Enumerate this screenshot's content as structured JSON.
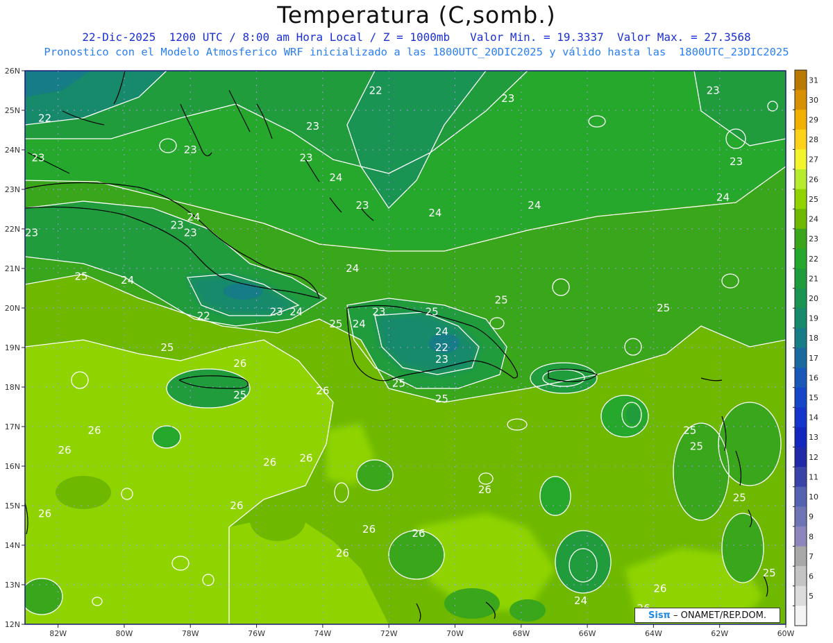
{
  "header": {
    "title": "Temperatura (C,somb.)",
    "line1": "22-Dic-2025  1200 UTC / 8:00 am Hora Local / Z = 1000mb   Valor Min. = 19.3337  Valor Max. = 27.3568",
    "line2": "Pronostico con el Modelo Atmosferico WRF inicializado a las 1800UTC_20DIC2025 y válido hasta las  1800UTC_23DIC2025"
  },
  "map": {
    "lat_labels": [
      "26N",
      "25N",
      "24N",
      "23N",
      "22N",
      "21N",
      "20N",
      "19N",
      "18N",
      "17N",
      "16N",
      "15N",
      "14N",
      "13N",
      "12N"
    ],
    "lon_labels": [
      "82W",
      "80W",
      "78W",
      "76W",
      "74W",
      "72W",
      "70W",
      "68W",
      "66W",
      "64W",
      "62W",
      "60W"
    ],
    "contour_labels": [
      {
        "text": "22",
        "lon": -82.4,
        "lat": 24.8
      },
      {
        "text": "23",
        "lon": -82.6,
        "lat": 23.8
      },
      {
        "text": "23",
        "lon": -82.8,
        "lat": 21.9
      },
      {
        "text": "25",
        "lon": -81.3,
        "lat": 20.8
      },
      {
        "text": "24",
        "lon": -79.9,
        "lat": 20.7
      },
      {
        "text": "23",
        "lon": -78.0,
        "lat": 24.0
      },
      {
        "text": "24",
        "lon": -77.9,
        "lat": 22.3
      },
      {
        "text": "23",
        "lon": -78.4,
        "lat": 22.1
      },
      {
        "text": "23",
        "lon": -78.0,
        "lat": 21.9
      },
      {
        "text": "22",
        "lon": -77.6,
        "lat": 19.8
      },
      {
        "text": "23",
        "lon": -74.3,
        "lat": 24.6
      },
      {
        "text": "23",
        "lon": -74.5,
        "lat": 23.8
      },
      {
        "text": "24",
        "lon": -73.6,
        "lat": 23.3
      },
      {
        "text": "23",
        "lon": -75.4,
        "lat": 19.9
      },
      {
        "text": "24",
        "lon": -74.8,
        "lat": 19.9
      },
      {
        "text": "25",
        "lon": -78.7,
        "lat": 19.0
      },
      {
        "text": "26",
        "lon": -76.5,
        "lat": 18.6
      },
      {
        "text": "25",
        "lon": -76.5,
        "lat": 17.8
      },
      {
        "text": "26",
        "lon": -80.9,
        "lat": 16.9
      },
      {
        "text": "26",
        "lon": -81.8,
        "lat": 16.4
      },
      {
        "text": "26",
        "lon": -82.4,
        "lat": 14.8
      },
      {
        "text": "26",
        "lon": -76.6,
        "lat": 15.0
      },
      {
        "text": "26",
        "lon": -75.6,
        "lat": 16.1
      },
      {
        "text": "26",
        "lon": -74.5,
        "lat": 16.2
      },
      {
        "text": "26",
        "lon": -74.0,
        "lat": 17.9
      },
      {
        "text": "25",
        "lon": -73.6,
        "lat": 19.6
      },
      {
        "text": "24",
        "lon": -72.9,
        "lat": 19.6
      },
      {
        "text": "23",
        "lon": -72.3,
        "lat": 19.9
      },
      {
        "text": "25",
        "lon": -70.7,
        "lat": 19.9
      },
      {
        "text": "24",
        "lon": -70.4,
        "lat": 19.4
      },
      {
        "text": "22",
        "lon": -70.4,
        "lat": 19.0
      },
      {
        "text": "23",
        "lon": -70.4,
        "lat": 18.7
      },
      {
        "text": "25",
        "lon": -71.7,
        "lat": 18.1
      },
      {
        "text": "25",
        "lon": -70.4,
        "lat": 17.7
      },
      {
        "text": "22",
        "lon": -72.4,
        "lat": 25.5
      },
      {
        "text": "23",
        "lon": -72.8,
        "lat": 22.6
      },
      {
        "text": "24",
        "lon": -73.1,
        "lat": 21.0
      },
      {
        "text": "24",
        "lon": -70.6,
        "lat": 22.4
      },
      {
        "text": "23",
        "lon": -68.4,
        "lat": 25.3
      },
      {
        "text": "24",
        "lon": -67.6,
        "lat": 22.6
      },
      {
        "text": "25",
        "lon": -68.6,
        "lat": 20.2
      },
      {
        "text": "23",
        "lon": -62.2,
        "lat": 25.5
      },
      {
        "text": "24",
        "lon": -61.9,
        "lat": 22.8
      },
      {
        "text": "23",
        "lon": -61.5,
        "lat": 23.7
      },
      {
        "text": "25",
        "lon": -63.7,
        "lat": 20.0
      },
      {
        "text": "25",
        "lon": -62.9,
        "lat": 16.9
      },
      {
        "text": "25",
        "lon": -62.7,
        "lat": 16.5
      },
      {
        "text": "25",
        "lon": -61.4,
        "lat": 15.2
      },
      {
        "text": "26",
        "lon": -69.1,
        "lat": 15.4
      },
      {
        "text": "26",
        "lon": -72.6,
        "lat": 14.4
      },
      {
        "text": "26",
        "lon": -71.1,
        "lat": 14.3
      },
      {
        "text": "26",
        "lon": -73.4,
        "lat": 13.8
      },
      {
        "text": "24",
        "lon": -66.2,
        "lat": 12.6
      },
      {
        "text": "26",
        "lon": -63.8,
        "lat": 12.9
      },
      {
        "text": "26",
        "lon": -64.3,
        "lat": 12.4
      },
      {
        "text": "25",
        "lon": -60.5,
        "lat": 13.3
      }
    ]
  },
  "colorbar": {
    "levels": [
      "31",
      "30",
      "29",
      "28",
      "27",
      "26",
      "25",
      "24",
      "23",
      "22",
      "21",
      "20",
      "19",
      "18",
      "17",
      "16",
      "15",
      "14",
      "13",
      "12",
      "11",
      "10",
      "9",
      "8",
      "7",
      "6",
      "5"
    ],
    "colors": [
      "#b97a00",
      "#d99000",
      "#f2b000",
      "#ffd21a",
      "#f4f42a",
      "#b7ec2e",
      "#8fd400",
      "#6eb800",
      "#3aa61c",
      "#25a82c",
      "#219c3c",
      "#1a9452",
      "#168a6a",
      "#167c86",
      "#1a6aa0",
      "#1858b8",
      "#1646c8",
      "#1434cc",
      "#1426c0",
      "#1e2aa8",
      "#3a44a8",
      "#5562b0",
      "#6e74b4",
      "#8c86bc",
      "#a8a8a8",
      "#c4c4c4",
      "#dcdcdc",
      "#f4f4f4"
    ]
  },
  "credit": {
    "brand": "Sisπ",
    "text": " – ONAMET/REP.DOM."
  }
}
